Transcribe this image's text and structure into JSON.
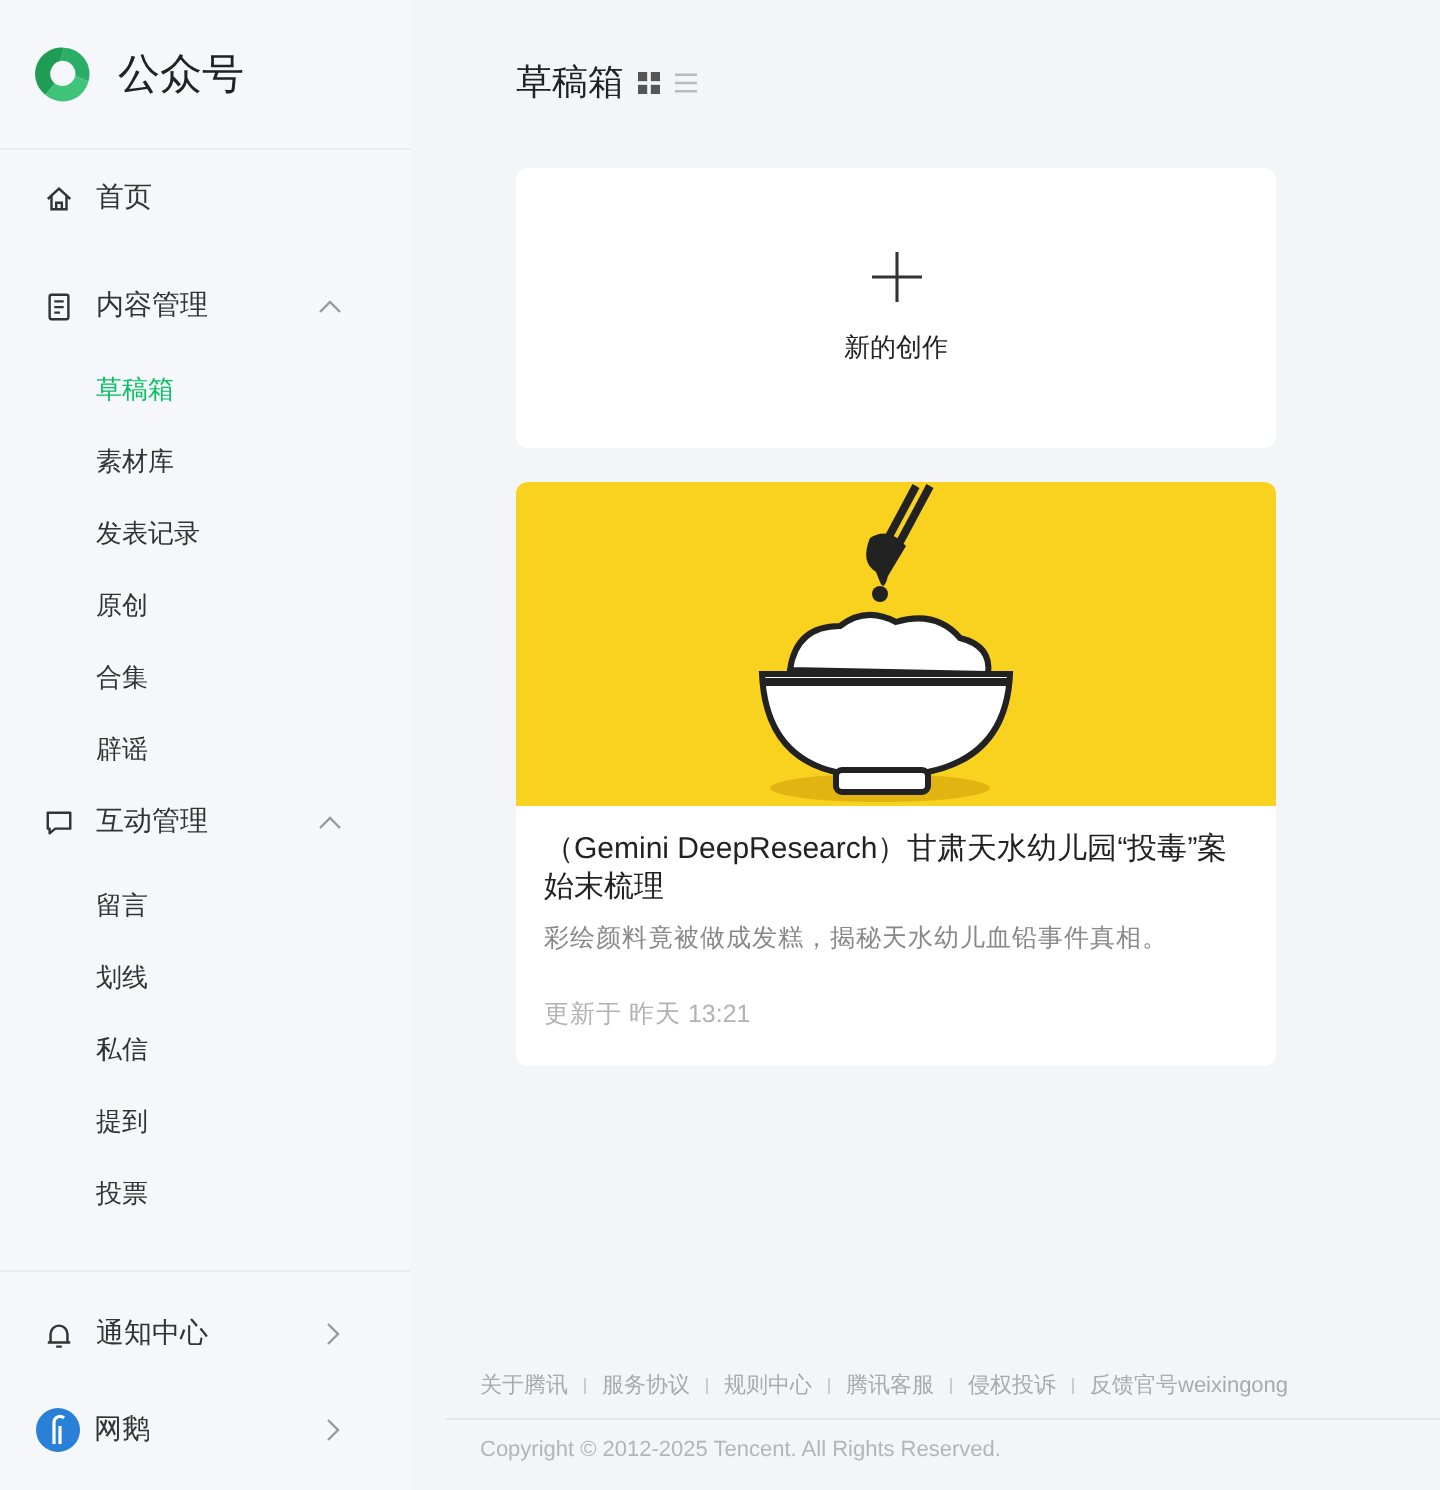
{
  "brand": {
    "name": "公众号"
  },
  "sidebar": {
    "items": [
      {
        "label": "首页",
        "kind": "link"
      },
      {
        "label": "内容管理",
        "kind": "group",
        "expanded": true,
        "children": [
          {
            "label": "草稿箱",
            "selected": true
          },
          {
            "label": "素材库",
            "selected": false
          },
          {
            "label": "发表记录",
            "selected": false
          },
          {
            "label": "原创",
            "selected": false
          },
          {
            "label": "合集",
            "selected": false
          },
          {
            "label": "辟谣",
            "selected": false
          }
        ]
      },
      {
        "label": "互动管理",
        "kind": "group",
        "expanded": true,
        "children": [
          {
            "label": "留言",
            "selected": false
          },
          {
            "label": "划线",
            "selected": false
          },
          {
            "label": "私信",
            "selected": false
          },
          {
            "label": "提到",
            "selected": false
          },
          {
            "label": "投票",
            "selected": false
          }
        ]
      }
    ],
    "bottom_items": [
      {
        "label": "通知中心",
        "kind": "notifications"
      },
      {
        "label": "网鹅",
        "kind": "account"
      }
    ]
  },
  "page": {
    "title": "草稿箱",
    "view_toggle": [
      {
        "selected": true
      },
      {
        "selected": false
      }
    ]
  },
  "create_card": {
    "label": "新的创作"
  },
  "drafts": [
    {
      "title": "（Gemini DeepResearch）甘肃天水幼儿园“投毒”案始末梳理",
      "summary": "彩绘颜料竟被做成发糕，揭秘天水幼儿血铅事件真相。",
      "updated": "更新于 昨天 13:21"
    }
  ],
  "footer": {
    "links": [
      "关于腾讯",
      "服务协议",
      "规则中心",
      "腾讯客服",
      "侵权投诉",
      "反馈官号weixingong"
    ],
    "copyright": "Copyright © 2012-2025 Tencent. All Rights Reserved."
  }
}
